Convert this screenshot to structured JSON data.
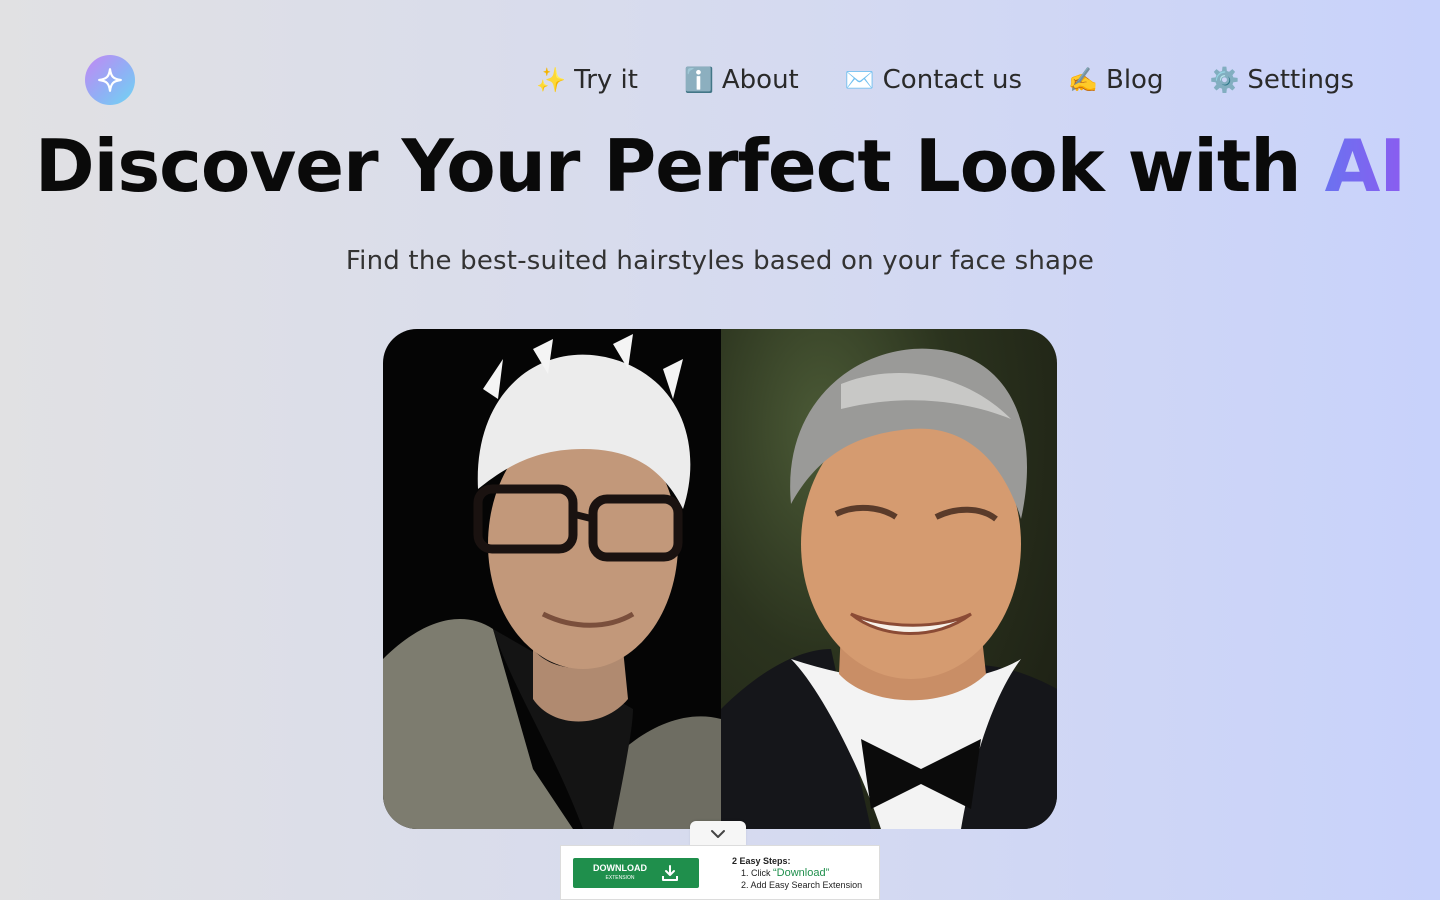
{
  "logo": {
    "icon": "sparkle-icon"
  },
  "nav": {
    "items": [
      {
        "emoji": "✨",
        "label": "Try it",
        "icon": "sparkles-icon"
      },
      {
        "emoji": "ℹ️",
        "label": "About",
        "icon": "info-icon"
      },
      {
        "emoji": "✉️",
        "label": "Contact us",
        "icon": "envelope-icon"
      },
      {
        "emoji": "✍️",
        "label": "Blog",
        "icon": "writing-hand-icon"
      },
      {
        "emoji": "⚙️",
        "label": "Settings",
        "icon": "gear-icon"
      }
    ]
  },
  "hero": {
    "headline_main": "Discover Your Perfect Look with ",
    "headline_accent": "AI",
    "subtitle": "Find the best-suited hairstyles based on your face shape",
    "accent_colors": [
      "#6b72f0",
      "#8b5cf0"
    ]
  },
  "ad": {
    "download_label": "DOWNLOAD",
    "download_sub": "EXTENSION",
    "steps_title": "2 Easy Steps:",
    "step1_prefix": "1. Click ",
    "step1_highlight": "“Download”",
    "step2": "2. Add Easy Search Extension",
    "button_color": "#1f8f4c"
  }
}
